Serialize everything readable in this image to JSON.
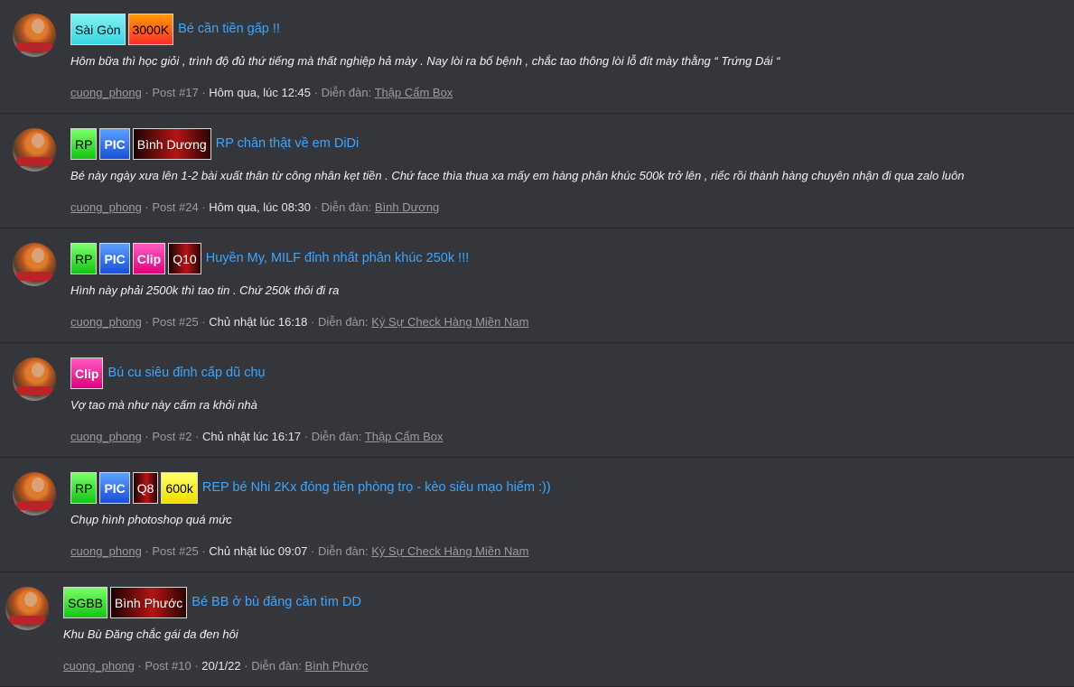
{
  "posts": [
    {
      "tags": [
        {
          "label": "Sài Gòn",
          "style": "saigon"
        },
        {
          "label": "3000K",
          "style": "price"
        }
      ],
      "title": "Bé cần tiền gấp !!",
      "snippet": "Hôm bữa thì học giỏi , trình độ đủ thứ tiếng mà thất nghiệp hả mày . Nay lòi ra bố bệnh , chắc tao thông lòi lỗ đít mày thằng “ Trứng Dái “",
      "user": "cuong_phong",
      "post_no": "Post #17",
      "time": "Hôm qua, lúc 12:45",
      "forum_label": "Diễn đàn:",
      "forum": "Thập Cẩm Box"
    },
    {
      "tags": [
        {
          "label": "RP",
          "style": "rp"
        },
        {
          "label": "PIC",
          "style": "pic"
        },
        {
          "label": "Bình Dương",
          "style": "dark"
        }
      ],
      "title": "RP chân thật về em DiDi",
      "snippet": "Bé này ngày xưa lên 1-2 bài xuất thân từ công nhân kẹt tiền . Chứ face thìa thua xa mấy em hàng phân khúc 500k trở lên , riếc rồi thành hàng chuyên nhận đi qua zalo luôn",
      "user": "cuong_phong",
      "post_no": "Post #24",
      "time": "Hôm qua, lúc 08:30",
      "forum_label": "Diễn đàn:",
      "forum": "Bình Dương"
    },
    {
      "tags": [
        {
          "label": "RP",
          "style": "rp"
        },
        {
          "label": "PIC",
          "style": "pic"
        },
        {
          "label": "Clip",
          "style": "clip"
        },
        {
          "label": "Q10",
          "style": "dark"
        }
      ],
      "title": "Huyền My, MILF đỉnh nhất phân khúc 250k !!!",
      "snippet": "Hình này phải 2500k thì tao tin . Chứ 250k thôi đi ra",
      "user": "cuong_phong",
      "post_no": "Post #25",
      "time": "Chủ nhật lúc 16:18",
      "forum_label": "Diễn đàn:",
      "forum": "Ký Sự Check Hàng Miền Nam"
    },
    {
      "tags": [
        {
          "label": "Clip",
          "style": "clip"
        }
      ],
      "title": "Bú cu siêu đỉnh cấp dũ chụ",
      "snippet": "Vợ tao mà như này cấm ra khỏi nhà",
      "user": "cuong_phong",
      "post_no": "Post #2",
      "time": "Chủ nhật lúc 16:17",
      "forum_label": "Diễn đàn:",
      "forum": "Thập Cẩm Box"
    },
    {
      "tags": [
        {
          "label": "RP",
          "style": "rp"
        },
        {
          "label": "PIC",
          "style": "pic"
        },
        {
          "label": "Q8",
          "style": "dark"
        },
        {
          "label": "600k",
          "style": "yellow"
        }
      ],
      "title": "REP bé Nhi 2Kx đóng tiền phòng trọ - kèo siêu mạo hiểm :))",
      "snippet": "Chụp hình photoshop quá mức",
      "user": "cuong_phong",
      "post_no": "Post #25",
      "time": "Chủ nhật lúc 09:07",
      "forum_label": "Diễn đàn:",
      "forum": "Ký Sự Check Hàng Miền Nam"
    },
    {
      "tags": [
        {
          "label": "SGBB",
          "style": "sgbb"
        },
        {
          "label": "Bình Phước",
          "style": "dark"
        }
      ],
      "title": "Bé BB ở bù đăng cần tìm DD",
      "snippet": "Khu Bù Đăng chắc gái da đen hôi",
      "user": "cuong_phong",
      "post_no": "Post #10",
      "time": "20/1/22",
      "forum_label": "Diễn đàn:",
      "forum": "Bình Phước"
    }
  ]
}
